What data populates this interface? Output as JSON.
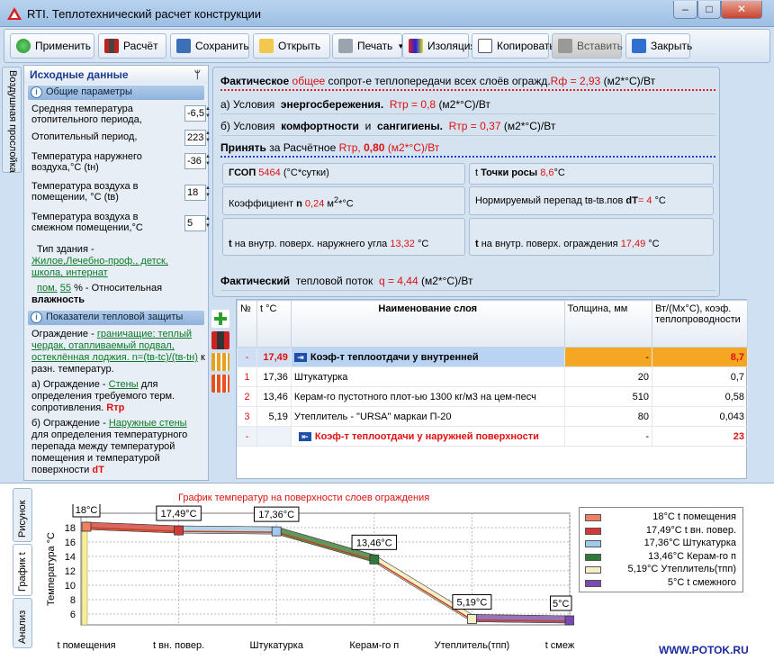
{
  "window": {
    "title": "RTI. Теплотехнический расчет конструкции",
    "min": "‒",
    "max": "□",
    "close": "✕"
  },
  "toolbar": {
    "apply": "Применить",
    "calc": "Расчёт",
    "save": "Сохранить",
    "open": "Открыть",
    "print": "Печать",
    "insulation": "Изоляция",
    "copy": "Копировать",
    "paste": "Вставить",
    "close": "Закрыть"
  },
  "side_tab": "Воздушная прослойка",
  "left": {
    "header": "Исходные данные",
    "general_header": "Общие параметры",
    "params": [
      {
        "label": "Средняя температура отопительного периода,",
        "value": "-6,5"
      },
      {
        "label": "Отопительный период,",
        "value": "223"
      },
      {
        "label": "Температура наружнего воздуха,°С (tн)",
        "value": "-36"
      },
      {
        "label": "Температура воздуха в помещении, °С (tв)",
        "value": "18"
      },
      {
        "label": "Температура воздуха в смежном помещении,°С",
        "value": "5"
      }
    ],
    "building_type_label": "Тип здания -",
    "building_type_value": "Жилое,Лечебно-проф., детск, школа, интернат",
    "humidity_prefix": "пом.",
    "humidity_value": "55",
    "humidity_unit": "%",
    "humidity_label": "- Относительная",
    "humidity_label2": "влажность",
    "protection_header": "Показатели тепловой защиты",
    "fence_prefix": "Ограждение -",
    "fence_value": "граничащие: теплый чердак, отапливаемый подвал, остеклённая лоджия. n=(tв-tc)/(tв-tн)",
    "fence_suffix": "к разн. температур.",
    "a_prefix": "а) Ограждение -",
    "a_value": "Стены",
    "a_text": "для определения требуемого терм. сопротивления.",
    "a_red": "Rтр",
    "b_prefix": "б) Ограждение -",
    "b_value": "Наружные стены",
    "b_text": "для определения температурного перепада между температурой помещения и температурой поверхности",
    "b_red": "dT"
  },
  "right": {
    "line1_bold": "Фактическое",
    "line1_red": "общее",
    "line1_text": "сопрот-е теплопередачи всех слоёв огражд.",
    "line1_value": "Rф = 2,93",
    "line1_unit": "(м2*°С)/Вт",
    "line2_text": "а) Условия",
    "line2_bold": "энергосбережения.",
    "line2_value": "Rтр = 0,8",
    "line2_unit": "(м2*°С)/Вт",
    "line3_text": "б) Условия",
    "line3_bold": "комфортности",
    "line3_and": "и",
    "line3_bold2": "сангигиены.",
    "line3_value": "Rтр = 0,37",
    "line3_unit": "(м2*°С)/Вт",
    "line4_bold": "Принять",
    "line4_text": "за Расчётное",
    "line4_value": "Rтр,",
    "line4_value2": "0,80",
    "line4_unit": "(м2*°С)/Вт",
    "gsop_label": "ГСОП",
    "gsop_value": "5464",
    "gsop_unit": "(°С*сутки)",
    "dew_label": "t",
    "dew_bold": "Точки росы",
    "dew_value": "8,6",
    "dew_unit": "°С",
    "coef_label": "Коэффициент",
    "coef_n": "n",
    "coef_value": "0,24",
    "coef_unit": "м",
    "coef_sup": "2",
    "coef_unit2": "*°С",
    "norm_label": "Нормируемый перепад tв-tв.пов",
    "norm_bold": "dT",
    "norm_value": "= 4",
    "norm_unit": "°С",
    "corner_t": "t",
    "corner_text": "на внутр. поверх. наружнего угла",
    "corner_value": "13,32",
    "corner_unit": "°С",
    "surf_t": "t",
    "surf_text": "на внутр. поверх. ограждения",
    "surf_value": "17,49",
    "surf_unit": "°С",
    "flow_bold": "Фактический",
    "flow_text": "тепловой поток",
    "flow_value": "q = 4,44",
    "flow_unit": "(м2*°С)/Вт"
  },
  "table": {
    "headers": [
      "№",
      "t °С",
      "Наименование слоя",
      "Толщина, мм",
      "Вт/(Мх°С), коэф. теплопроводности"
    ],
    "rows": [
      {
        "n": "-",
        "t": "17,49",
        "name": "Коэф-т теплоотдачи у внутренней",
        "thick": "-",
        "lambda": "8,7"
      },
      {
        "n": "1",
        "t": "17,36",
        "name": "Штукатурка",
        "thick": "20",
        "lambda": "0,7"
      },
      {
        "n": "2",
        "t": "13,46",
        "name": "Керам-го пустотного плот-ью 1300 кг/м3 на цем-песч",
        "thick": "510",
        "lambda": "0,58"
      },
      {
        "n": "3",
        "t": "5,19",
        "name": "Утеплитель - \"URSA\" маркаи П-20",
        "thick": "80",
        "lambda": "0,043"
      },
      {
        "n": "-",
        "t": "",
        "name": "Коэф-т теплоотдачи у наружней поверхности",
        "thick": "-",
        "lambda": "23"
      }
    ]
  },
  "bottom_tabs": [
    "Рисунок",
    "График t",
    "Анализ"
  ],
  "chart_data": {
    "type": "line",
    "title": "График температур на поверхности слоев ограждения",
    "ylabel": "Температура °С",
    "categories": [
      "t помещения",
      "t вн. повер.",
      "Штукатурка",
      "Керам-го п",
      "Утеплитель(тпп)",
      "t смежного"
    ],
    "values": [
      18,
      17.49,
      17.36,
      13.46,
      5.19,
      5
    ],
    "point_labels": [
      "18°С",
      "17,49°С",
      "17,36°С",
      "13,46°С",
      "5,19°С",
      "5°С"
    ],
    "yticks": [
      6,
      8,
      10,
      12,
      14,
      16,
      18
    ],
    "ylim": [
      4.5,
      20
    ],
    "grid": true,
    "legend_position": "right",
    "legend": [
      {
        "label": "18°С t помещения",
        "color": "#f08060"
      },
      {
        "label": "17,49°С t вн. повер.",
        "color": "#d23a3a"
      },
      {
        "label": "17,36°С Штукатурка",
        "color": "#9fc9ee"
      },
      {
        "label": "13,46°С Керам-го п",
        "color": "#2f7a3a"
      },
      {
        "label": "5,19°С Утеплитель(тпп)",
        "color": "#f3efc8"
      },
      {
        "label": "5°С t смежного",
        "color": "#7a4ab0"
      }
    ]
  },
  "site": "WWW.POTOK.RU"
}
